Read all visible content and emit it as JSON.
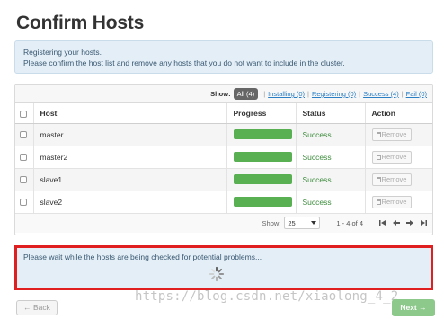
{
  "page": {
    "title": "Confirm Hosts"
  },
  "info": {
    "line1": "Registering your hosts.",
    "line2": "Please confirm the host list and remove any hosts that you do not want to include in the cluster."
  },
  "filter": {
    "label": "Show:",
    "all": "All (4)",
    "installing": "Installing (0)",
    "registering": "Registering (0)",
    "success": "Success (4)",
    "fail": "Fail (0)"
  },
  "table": {
    "headers": {
      "host": "Host",
      "progress": "Progress",
      "status": "Status",
      "action": "Action"
    },
    "rows": [
      {
        "host": "master",
        "progress": 100,
        "status": "Success",
        "action": "Remove"
      },
      {
        "host": "master2",
        "progress": 100,
        "status": "Success",
        "action": "Remove"
      },
      {
        "host": "slave1",
        "progress": 100,
        "status": "Success",
        "action": "Remove"
      },
      {
        "host": "slave2",
        "progress": 100,
        "status": "Success",
        "action": "Remove"
      }
    ]
  },
  "pager": {
    "label": "Show:",
    "page_size": "25",
    "range": "1 - 4 of 4"
  },
  "checks": {
    "message": "Please wait while the hosts are being checked for potential problems..."
  },
  "watermark": "https://blog.csdn.net/xiaolong_4_2",
  "buttons": {
    "back": "← Back",
    "next": "Next →"
  },
  "colors": {
    "success": "#58b053",
    "highlight_border": "#e02020",
    "info_bg": "#e3eef6"
  }
}
